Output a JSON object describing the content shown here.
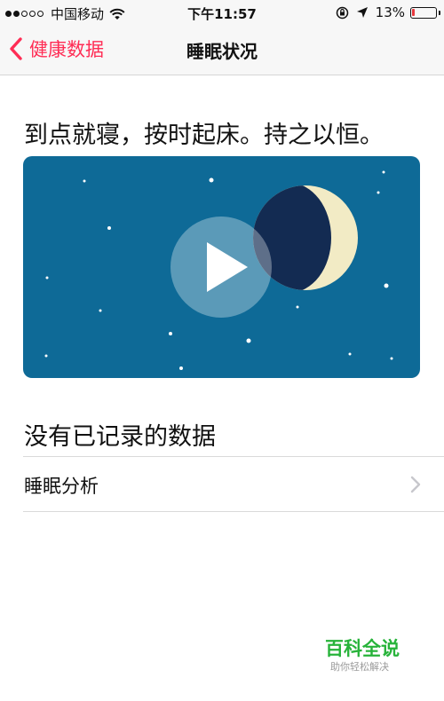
{
  "status_bar": {
    "signal_dots_filled": 2,
    "signal_dots_total": 5,
    "carrier": "中国移动",
    "time": "下午11:57",
    "battery_text": "13%",
    "battery_level": 0.13,
    "battery_color": "#e8383d"
  },
  "nav": {
    "back_label": "健康数据",
    "title": "睡眠状况",
    "accent_color": "#ff2d55"
  },
  "main": {
    "headline": "到点就寝，按时起床。持之以恒。",
    "video": {
      "background_color": "#0e6a97",
      "play_icon": "play-icon"
    },
    "empty_state": "没有已记录的数据",
    "rows": [
      {
        "label": "睡眠分析"
      }
    ]
  },
  "watermark": {
    "title": "百科全说",
    "subtitle": "助你轻松解决"
  }
}
